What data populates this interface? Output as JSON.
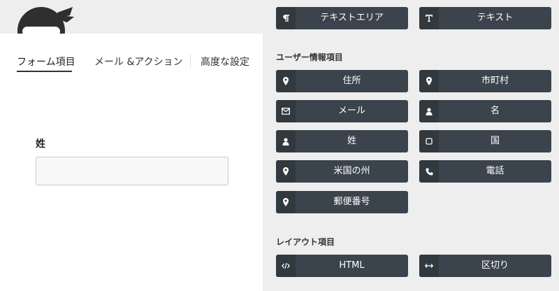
{
  "tabs": [
    {
      "label": "フォーム項目"
    },
    {
      "label": "メール &アクション"
    },
    {
      "label": "高度な設定"
    }
  ],
  "field": {
    "label": "姓",
    "value": ""
  },
  "buttons_top": [
    {
      "label": "テキストエリア",
      "icon": "paragraph-icon"
    },
    {
      "label": "テキスト",
      "icon": "text-icon"
    }
  ],
  "sections": {
    "user_info": {
      "title": "ユーザー情報項目",
      "buttons": [
        {
          "label": "住所",
          "icon": "map-pin-icon"
        },
        {
          "label": "市町村",
          "icon": "map-pin-icon"
        },
        {
          "label": "メール",
          "icon": "envelope-icon"
        },
        {
          "label": "名",
          "icon": "user-icon"
        },
        {
          "label": "姓",
          "icon": "user-icon"
        },
        {
          "label": "国",
          "icon": "square-icon"
        },
        {
          "label": "米国の州",
          "icon": "map-pin-icon"
        },
        {
          "label": "電話",
          "icon": "phone-icon"
        },
        {
          "label": "郵便番号",
          "icon": "map-pin-icon"
        }
      ]
    },
    "layout": {
      "title": "レイアウト項目",
      "buttons": [
        {
          "label": "HTML",
          "icon": "code-icon"
        },
        {
          "label": "区切り",
          "icon": "arrows-horizontal-icon"
        }
      ]
    }
  },
  "colors": {
    "button_bg": "#3b444c",
    "button_icon_bg": "#31393f",
    "panel_bg": "#eeeeef"
  }
}
